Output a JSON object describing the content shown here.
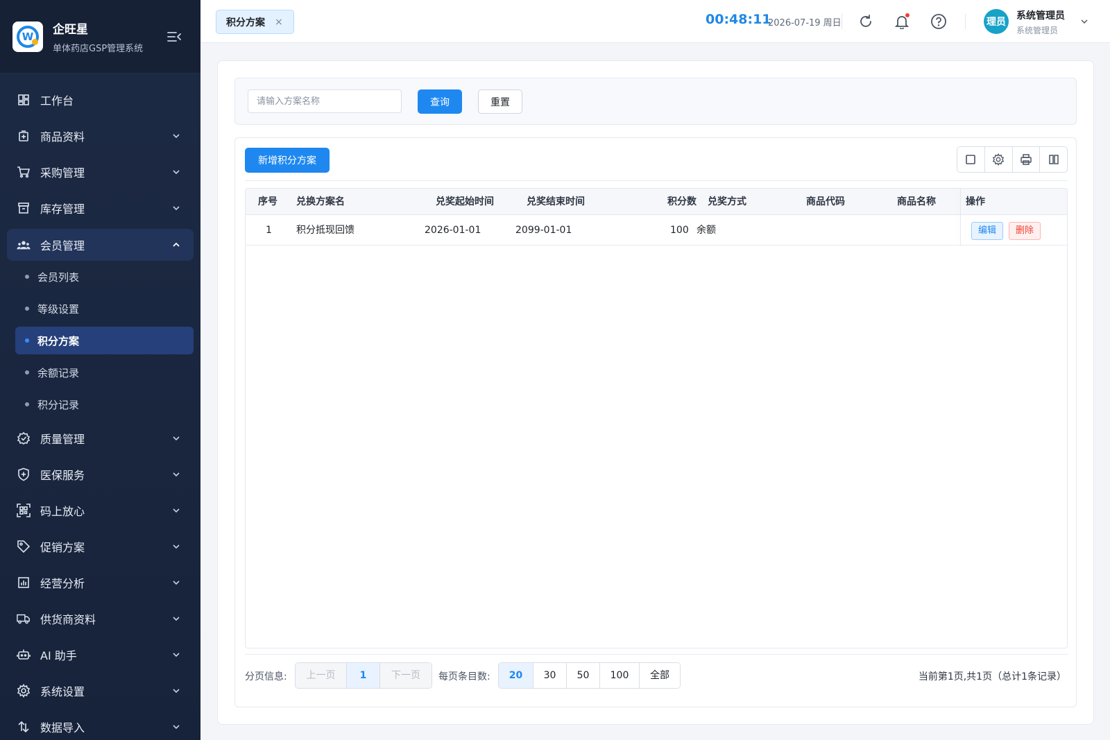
{
  "brand": {
    "name": "企旺星",
    "subtitle": "单体药店GSP管理系统"
  },
  "sidebar": {
    "items": [
      {
        "label": "工作台",
        "icon": "dashboard-icon",
        "expandable": false
      },
      {
        "label": "商品资料",
        "icon": "product-icon",
        "expandable": true
      },
      {
        "label": "采购管理",
        "icon": "cart-icon",
        "expandable": true
      },
      {
        "label": "库存管理",
        "icon": "inventory-icon",
        "expandable": true
      },
      {
        "label": "会员管理",
        "icon": "members-icon",
        "expandable": true,
        "open": true,
        "children": [
          {
            "label": "会员列表",
            "active": false
          },
          {
            "label": "等级设置",
            "active": false
          },
          {
            "label": "积分方案",
            "active": true
          },
          {
            "label": "余额记录",
            "active": false
          },
          {
            "label": "积分记录",
            "active": false
          }
        ]
      },
      {
        "label": "质量管理",
        "icon": "quality-badge-icon",
        "expandable": true
      },
      {
        "label": "医保服务",
        "icon": "shield-plus-icon",
        "expandable": true
      },
      {
        "label": "码上放心",
        "icon": "qrcode-scan-icon",
        "expandable": true
      },
      {
        "label": "促销方案",
        "icon": "tag-icon",
        "expandable": true
      },
      {
        "label": "经营分析",
        "icon": "chart-icon",
        "expandable": true
      },
      {
        "label": "供货商资料",
        "icon": "truck-icon",
        "expandable": true
      },
      {
        "label": "AI 助手",
        "icon": "robot-icon",
        "expandable": true
      },
      {
        "label": "系统设置",
        "icon": "gear-icon",
        "expandable": true
      },
      {
        "label": "数据导入",
        "icon": "import-icon",
        "expandable": true
      }
    ]
  },
  "header": {
    "tab_label": "积分方案",
    "tab_close": "×",
    "clock": "00:48:11",
    "date": "2026-07-19 周日",
    "user": {
      "avatar_text": "理员",
      "name": "系统管理员",
      "role": "系统管理员"
    }
  },
  "search": {
    "placeholder": "请输入方案名称",
    "value": "",
    "query_label": "查询",
    "reset_label": "重置"
  },
  "toolbar": {
    "add_label": "新增积分方案"
  },
  "table": {
    "columns": [
      "序号",
      "兑换方案名",
      "兑奖起始时间",
      "兑奖结束时间",
      "积分数",
      "兑奖方式",
      "商品代码",
      "商品名称",
      "操作"
    ],
    "rows": [
      {
        "index": "1",
        "name": "积分抵现回馈",
        "start": "2026-01-01",
        "end": "2099-01-01",
        "points": "100",
        "method": "余额",
        "code": "",
        "product": "",
        "edit": "编辑",
        "delete": "删除"
      }
    ]
  },
  "pager": {
    "info_label": "分页信息:",
    "prev": "上一页",
    "current": "1",
    "next": "下一页",
    "size_label": "每页条目数:",
    "sizes": [
      "20",
      "30",
      "50",
      "100",
      "全部"
    ],
    "summary": "当前第1页,共1页（总计1条记录）"
  },
  "colors": {
    "primary": "#1e88f0",
    "sidebar_bg": "#1d2a44",
    "danger": "#f04134"
  }
}
